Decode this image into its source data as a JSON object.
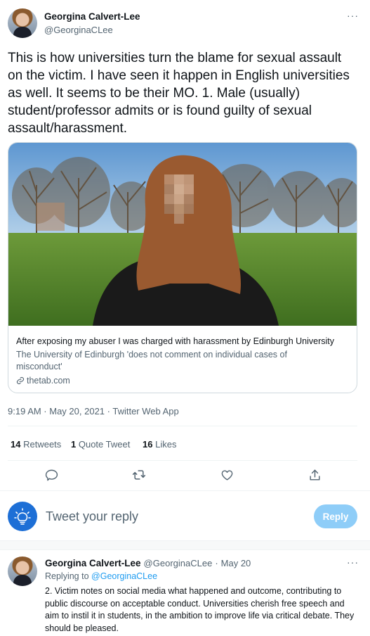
{
  "tweet": {
    "author_name": "Georgina Calvert-Lee",
    "author_handle": "@GeorginaCLee",
    "more_glyph": "···",
    "text": "This is how universities turn the blame for sexual assault on the victim. I have seen it happen in English universities as well. It seems to be their MO. 1. Male (usually) student/professor admits or is found guilty of sexual assault/harassment.",
    "card": {
      "title": "After exposing my abuser I was charged with harassment by Edinburgh University",
      "description": "The University of Edinburgh 'does not comment on individual cases of misconduct'",
      "domain": "thetab.com"
    },
    "timestamp": "9:19 AM · May 20, 2021 · Twitter Web App",
    "stats": {
      "retweets_count": "14",
      "retweets_label": "Retweets",
      "quotes_count": "1",
      "quotes_label": "Quote Tweet",
      "likes_count": "16",
      "likes_label": "Likes"
    }
  },
  "composer": {
    "placeholder": "Tweet your reply",
    "button_label": "Reply"
  },
  "reply": {
    "author_name": "Georgina Calvert-Lee",
    "author_handle": "@GeorginaCLee",
    "separator": "·",
    "date": "May 20",
    "more_glyph": "···",
    "replying_to_label": "Replying to",
    "replying_to_handle": "@GeorginaCLee",
    "text": "2. Victim notes on social media what happened and outcome, contributing to public discourse on acceptable conduct. Universities cherish free speech and aim to instil it in students, in the ambition to improve life via critical debate. They should be pleased."
  },
  "colors": {
    "accent": "#1d9bf0",
    "reply_button": "#8ecdf8",
    "muted_text": "#536471"
  },
  "icons": [
    "reply-icon",
    "retweet-icon",
    "like-icon",
    "share-icon",
    "link-icon",
    "lightbulb-avatar-icon",
    "more-icon"
  ]
}
